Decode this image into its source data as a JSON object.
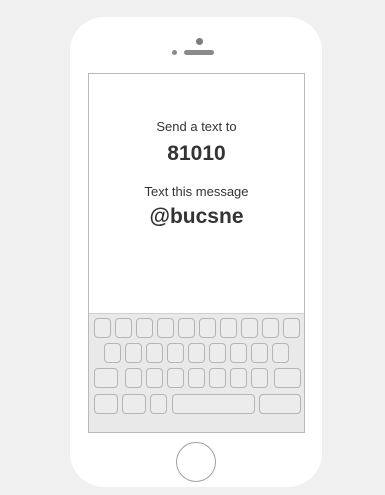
{
  "screen": {
    "line1": "Send a text to",
    "number": "81010",
    "line2": "Text this message",
    "message": "@bucsne"
  }
}
